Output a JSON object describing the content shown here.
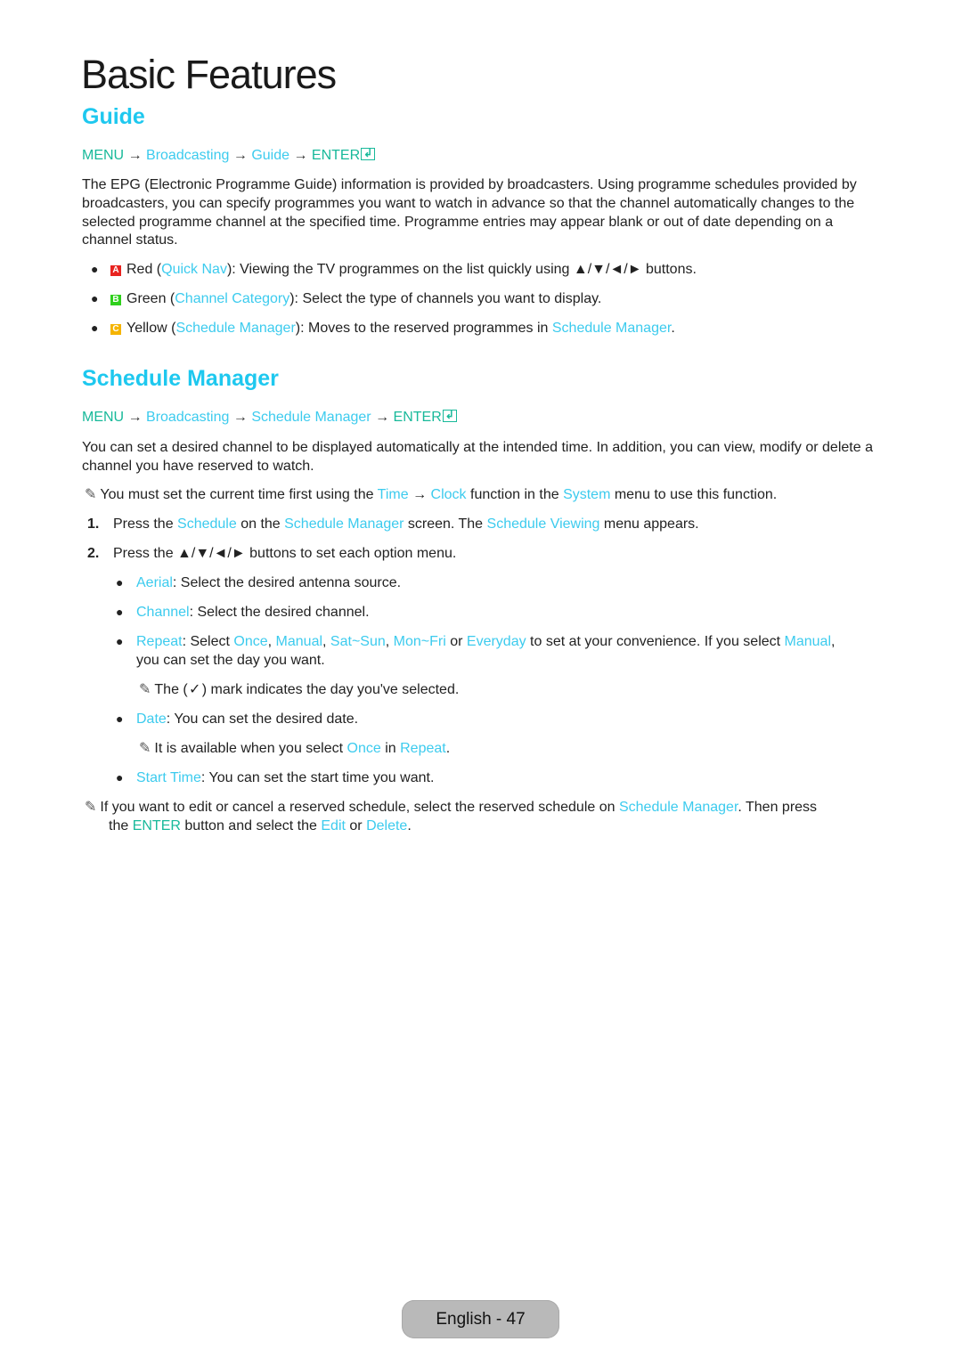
{
  "page": {
    "title": "Basic Features",
    "footer": "English - 47"
  },
  "guide": {
    "heading": "Guide",
    "path": {
      "menu": "MENU",
      "arrow": "→",
      "step1": "Broadcasting",
      "step2": "Guide",
      "enter": "ENTER",
      "enter_icon": "enter-icon"
    },
    "description": "The EPG (Electronic Programme Guide) information is provided by broadcasters. Using programme schedules provided by broadcasters, you can specify programmes you want to watch in advance so that the channel automatically changes to the selected programme channel at the specified time. Programme entries may appear blank or out of date depending on a channel status.",
    "bullets": [
      {
        "key": "A",
        "key_color": "#e8231f",
        "color_name": "Red",
        "open": " (",
        "feature": "Quick Nav",
        "close": "): ",
        "text": "Viewing the TV programmes on the list quickly using ▲/▼/◄/► buttons."
      },
      {
        "key": "B",
        "key_color": "#2fd01c",
        "color_name": "Green",
        "open": " (",
        "feature": "Channel Category",
        "close": "): ",
        "text": "Select the type of channels you want to display."
      },
      {
        "key": "C",
        "key_color": "#f5b400",
        "color_name": "Yellow",
        "open": " (",
        "feature": "Schedule Manager",
        "close": "): ",
        "text": "Moves to the reserved programmes in ",
        "link": "Schedule Manager",
        "end": "."
      }
    ]
  },
  "schedule_manager": {
    "heading": "Schedule Manager",
    "path": {
      "menu": "MENU",
      "arrow": "→",
      "step1": "Broadcasting",
      "step2": "Schedule Manager",
      "enter": "ENTER",
      "enter_icon": "enter-icon"
    },
    "description": "You can set a desired channel to be displayed automatically at the intended time. In addition, you can view, modify or delete a channel you have reserved to watch.",
    "note1": {
      "icon": "note-pencil-icon",
      "t1": "You must set the current time first using the ",
      "l1": "Time",
      "arrow": " → ",
      "l2": "Clock",
      "t2": " function in the ",
      "l3": "System",
      "t3": " menu to use this function."
    },
    "step1": {
      "num": "1.",
      "t1": "Press the ",
      "l1": "Schedule",
      "t2": " on the ",
      "l2": "Schedule Manager",
      "t3": " screen. The ",
      "l3": "Schedule Viewing",
      "t4": " menu appears."
    },
    "step2": {
      "num": "2.",
      "text": "Press the ▲/▼/◄/► buttons to set each option menu."
    },
    "options": {
      "aerial": {
        "label": "Aerial",
        "text": ": Select the desired antenna source."
      },
      "channel": {
        "label": "Channel",
        "text": ": Select the desired channel."
      },
      "repeat": {
        "label": "Repeat",
        "t1": ": Select ",
        "o1": "Once",
        "c1": ", ",
        "o2": "Manual",
        "c2": ", ",
        "o3": "Sat~Sun",
        "c3": ", ",
        "o4": "Mon~Fri",
        "c4": " or ",
        "o5": "Everyday",
        "t2": " to set at your convenience. If you select ",
        "o6": "Manual",
        "t3": ",",
        "line2": "you can set the day you want.",
        "note": {
          "t1": "The (",
          "icon": "checkmark-icon",
          "t2": ") mark indicates the day you've selected."
        }
      },
      "date": {
        "label": "Date",
        "text": ": You can set the desired date.",
        "note": {
          "t1": "It is available when you select ",
          "l1": "Once",
          "t2": " in ",
          "l2": "Repeat",
          "t3": "."
        }
      },
      "start_time": {
        "label": "Start Time",
        "text": ": You can set the start time you want."
      }
    },
    "note2": {
      "t1": "If you want to edit or cancel a reserved schedule, select the reserved schedule on ",
      "l1": "Schedule Manager",
      "t2": ". Then press",
      "line2_t1": "the ",
      "enter": "ENTER",
      "line2_t2": " button and select the ",
      "l2": "Edit",
      "line2_t3": " or ",
      "l3": "Delete",
      "line2_t4": "."
    }
  },
  "colors": {
    "heading": "#1ec8ef",
    "link": "#3ccbee",
    "menu_keyword": "#18b99a",
    "footer_bg": "#b9b9b9"
  }
}
